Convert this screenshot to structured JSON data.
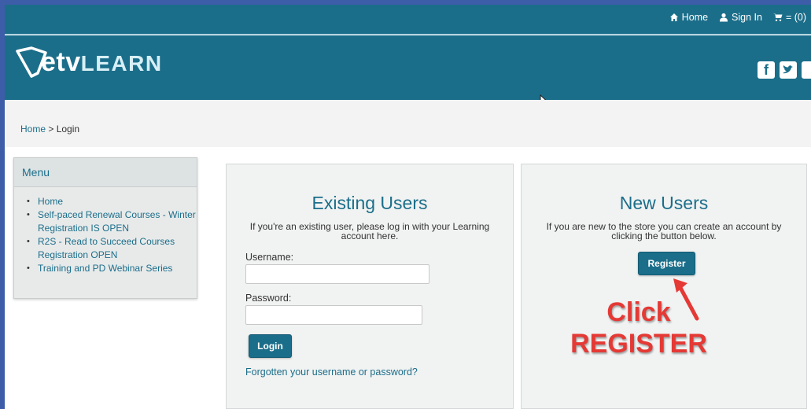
{
  "topbar": {
    "home_label": "Home",
    "signin_label": "Sign In",
    "cart_label": "= (0)"
  },
  "brand": {
    "logo_main": "etv",
    "logo_sub": "LEARN",
    "social_icons": [
      "facebook-icon",
      "twitter-icon",
      "other-social-icon"
    ]
  },
  "breadcrumb": {
    "home": "Home",
    "separator": " > ",
    "current": "Login"
  },
  "menu": {
    "title": "Menu",
    "items": [
      {
        "label": "Home"
      },
      {
        "label": "Self-paced Renewal Courses - Winter Registration IS OPEN"
      },
      {
        "label": "R2S - Read to Succeed Courses Registration OPEN"
      },
      {
        "label": "Training and PD Webinar Series"
      }
    ]
  },
  "existing": {
    "title": "Existing Users",
    "description": "If you're an existing user, please log in with your Learning account here.",
    "username_label": "Username:",
    "username_value": "",
    "password_label": "Password:",
    "password_value": "",
    "login_label": "Login",
    "forgot_label": "Forgotten your username or password?"
  },
  "newusers": {
    "title": "New Users",
    "description": "If you are new to the store you can create an account by clicking the button below.",
    "register_label": "Register"
  },
  "annotation": {
    "line1": "Click",
    "line2": "REGISTER",
    "color": "#e53935"
  },
  "colors": {
    "brand": "#1b6e8a",
    "frame": "#3d5da8"
  }
}
